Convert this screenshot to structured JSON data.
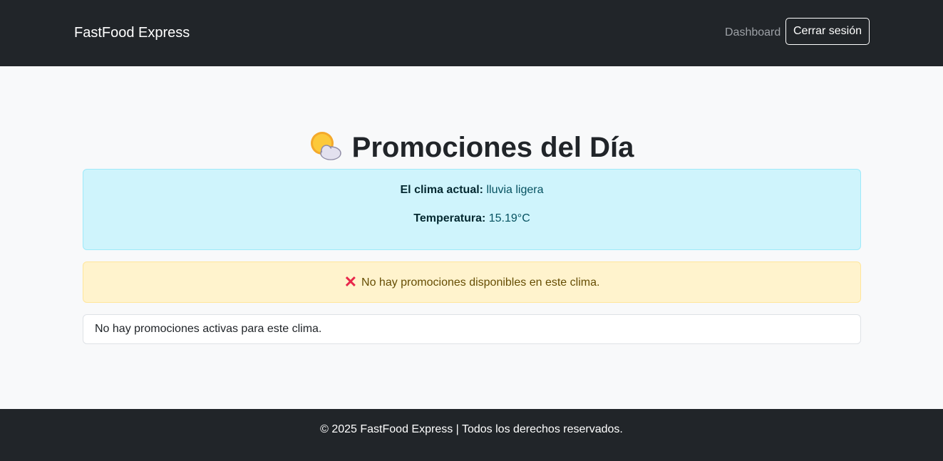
{
  "navbar": {
    "brand": "FastFood Express",
    "dashboard_label": "Dashboard",
    "logout_label": "Cerrar sesión"
  },
  "main": {
    "title_icon": "sun-behind-cloud-icon",
    "title": "Promociones del Día",
    "weather": {
      "condition_label": "El clima actual:",
      "condition_value": "lluvia ligera",
      "temperature_label": "Temperatura:",
      "temperature_value": "15.19°C"
    },
    "warning": {
      "icon": "cross-mark-icon",
      "text": "No hay promociones disponibles en este clima."
    },
    "empty_list_text": "No hay promociones activas para este clima."
  },
  "footer": {
    "text": "© 2025 FastFood Express | Todos los derechos reservados."
  },
  "colors": {
    "navbar_bg": "#212529",
    "info_bg": "#cff4fc",
    "warning_bg": "#fff3cd",
    "cross_mark": "#e8264a"
  }
}
